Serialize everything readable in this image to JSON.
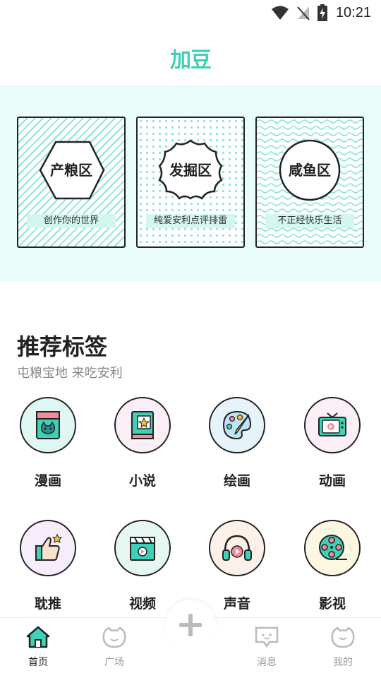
{
  "status": {
    "time": "10:21"
  },
  "header": {
    "logo_text": "加豆"
  },
  "zones": [
    {
      "title": "产粮区",
      "subtitle": "创作你的世界"
    },
    {
      "title": "发掘区",
      "subtitle": "纯爱安利点评排雷"
    },
    {
      "title": "咸鱼区",
      "subtitle": "不正经快乐生活"
    }
  ],
  "recommended": {
    "title": "推荐标签",
    "subtitle": "屯粮宝地 来吃安利",
    "tags": [
      {
        "label": "漫画",
        "icon": "comic-book-icon",
        "bg": "#dff7f3"
      },
      {
        "label": "小说",
        "icon": "novel-book-icon",
        "bg": "#fbeef6"
      },
      {
        "label": "绘画",
        "icon": "palette-icon",
        "bg": "#e6f3fb"
      },
      {
        "label": "动画",
        "icon": "tv-icon",
        "bg": "#fbeef6"
      },
      {
        "label": "耽推",
        "icon": "thumbs-up-icon",
        "bg": "#f6ecfb"
      },
      {
        "label": "视频",
        "icon": "clapperboard-icon",
        "bg": "#e6f7f1"
      },
      {
        "label": "声音",
        "icon": "headphones-icon",
        "bg": "#fdf0e8"
      },
      {
        "label": "影视",
        "icon": "film-reel-icon",
        "bg": "#fdf7e2"
      }
    ]
  },
  "nav": {
    "home": "首页",
    "square": "广场",
    "messages": "消息",
    "mine": "我的"
  },
  "colors": {
    "accent": "#3fd0b8",
    "banner_bg": "#e8fcfa"
  }
}
